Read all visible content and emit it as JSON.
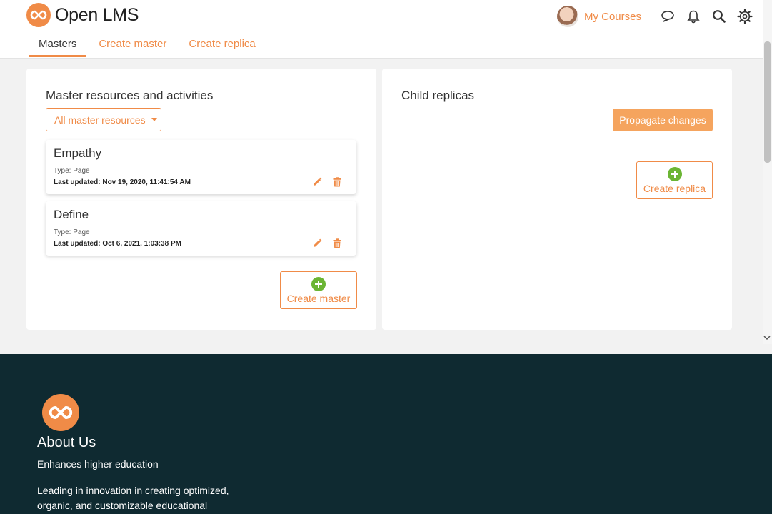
{
  "header": {
    "brand": "Open LMS",
    "my_courses": "My Courses",
    "icons": [
      "chat-icon",
      "bell-icon",
      "search-icon",
      "gear-icon"
    ]
  },
  "tabs": [
    {
      "label": "Masters",
      "active": true
    },
    {
      "label": "Create master",
      "active": false
    },
    {
      "label": "Create replica",
      "active": false
    }
  ],
  "left_panel": {
    "title": "Master resources and activities",
    "filter": "All master resources",
    "items": [
      {
        "title": "Empathy",
        "type": "Type: Page",
        "updated_label": "Last updated:",
        "updated": "Nov 19, 2020, 11:41:54 AM"
      },
      {
        "title": "Define",
        "type": "Type: Page",
        "updated_label": "Last updated:",
        "updated": "Oct 6, 2021, 1:03:38 PM"
      }
    ],
    "create_label": "Create master"
  },
  "right_panel": {
    "title": "Child replicas",
    "propagate_label": "Propagate changes",
    "create_label": "Create replica"
  },
  "footer": {
    "title": "About Us",
    "tagline": "Enhances higher education",
    "description": "Leading in innovation in creating optimized, organic, and customizable educational"
  },
  "colors": {
    "accent": "#f08b47",
    "success": "#6bb534",
    "footer_bg": "#0f2a31"
  }
}
